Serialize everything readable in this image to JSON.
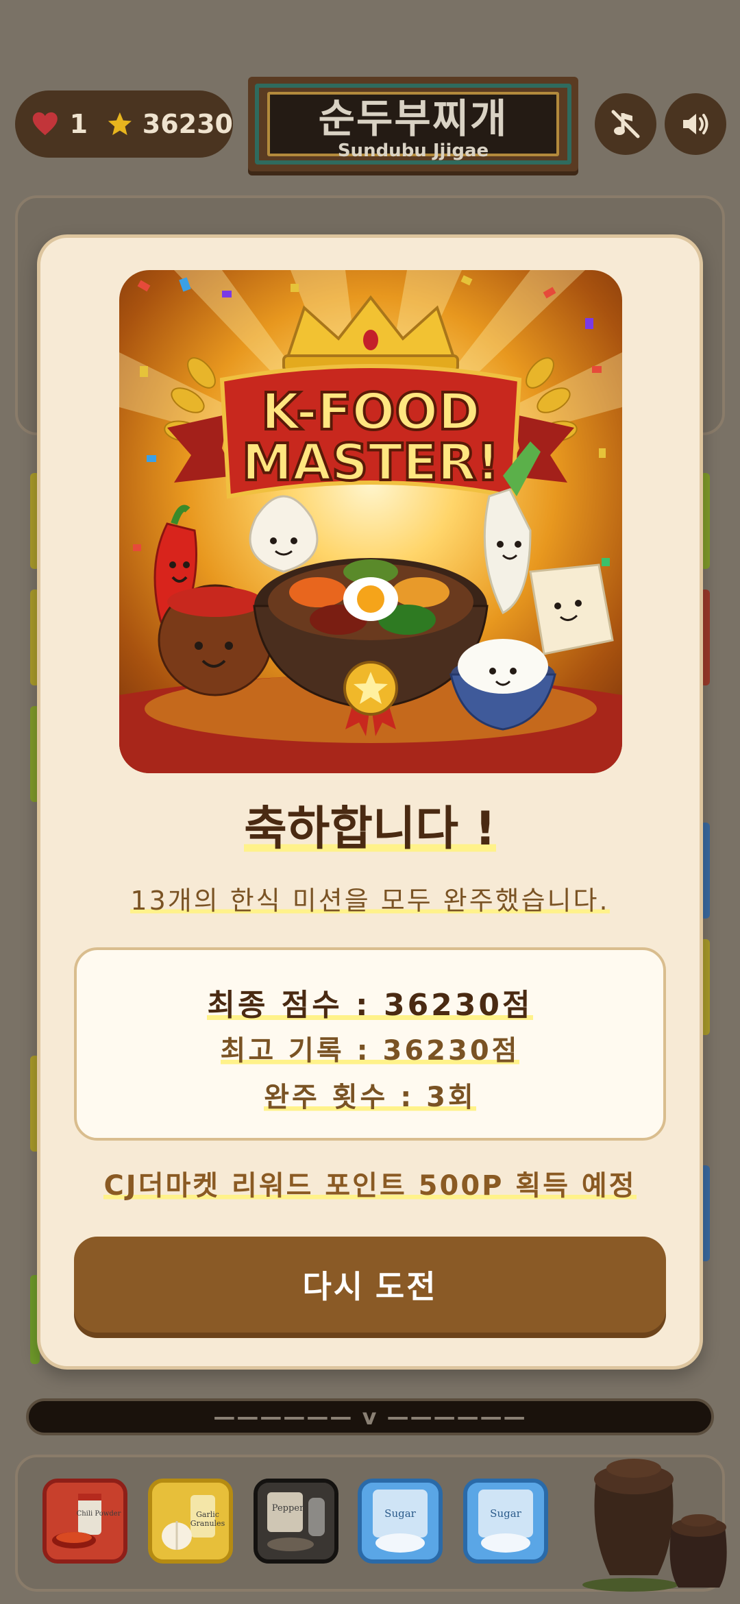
{
  "header": {
    "lives": "1",
    "score": "36230",
    "title_ko": "순두부찌개",
    "title_en": "Sundubu Jjigae",
    "music_icon": "music-off-icon",
    "sound_icon": "speaker-icon"
  },
  "result_modal": {
    "banner_line1": "K-FOOD",
    "banner_line2": "MASTER!",
    "heading": "축하합니다 !",
    "subheading": "13개의 한식 미션을 모두 완주했습니다.",
    "final_score": "최종 점수 : 36230점",
    "best_record": "최고 기록 : 36230점",
    "completion_count": "완주 횟수 : 3회",
    "reward_text": "CJ더마켓 리워드 포인트 500P 획득 예정",
    "retry_label": "다시 도전"
  },
  "ticker": {
    "text": "——————  v  ——————"
  },
  "ingredient_tray": [
    {
      "label": "Chili Powder",
      "color": "#c0301f"
    },
    {
      "label": "Garlic Granules",
      "color": "#e2b321"
    },
    {
      "label": "Pepper",
      "color": "#2c2a28"
    },
    {
      "label": "Sugar",
      "color": "#3f8fd8"
    },
    {
      "label": "Sugar",
      "color": "#3f8fd8"
    }
  ],
  "colors": {
    "accent_brown": "#8a5a26",
    "panel_cream": "#f7ead5",
    "highlight": "#fff28a"
  }
}
